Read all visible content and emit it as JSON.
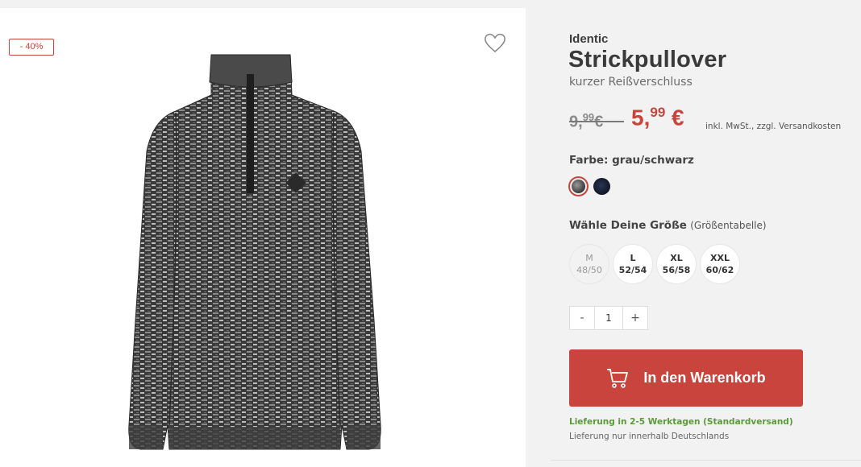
{
  "product": {
    "discount_badge": "- 40%",
    "brand": "Identic",
    "title": "Strickpullover",
    "subtitle": "kurzer Reißverschluss",
    "old_price_main": "9,",
    "old_price_cents": "99",
    "old_price_currency": "€",
    "new_price_main": "5,",
    "new_price_cents": "99",
    "new_price_currency": " €",
    "tax_note": "inkl. MwSt., zzgl. Versandkosten"
  },
  "color": {
    "label": "Farbe: grau/schwarz",
    "swatches": [
      {
        "name": "grau/schwarz",
        "hex": "#5a5a5a",
        "selected": true
      },
      {
        "name": "navy",
        "hex": "#151c2e",
        "selected": false
      }
    ]
  },
  "size": {
    "label": "Wähle Deine Größe",
    "chart_link": "(Größentabelle)",
    "options": [
      {
        "label": "M",
        "range": "48/50",
        "available": false
      },
      {
        "label": "L",
        "range": "52/54",
        "available": true
      },
      {
        "label": "XL",
        "range": "56/58",
        "available": true
      },
      {
        "label": "XXL",
        "range": "60/62",
        "available": true
      }
    ]
  },
  "quantity": {
    "minus": "-",
    "value": "1",
    "plus": "+"
  },
  "cart": {
    "label": "In den Warenkorb",
    "icon": "shopping-cart-icon"
  },
  "delivery": {
    "time": "Lieferung in 2-5 Werktagen (Standardversand)",
    "note": "Lieferung nur innerhalb Deutschlands"
  },
  "icons": {
    "wishlist": "heart-outline-icon"
  },
  "colors": {
    "accent": "#c9443d",
    "success": "#5a9a3a"
  }
}
